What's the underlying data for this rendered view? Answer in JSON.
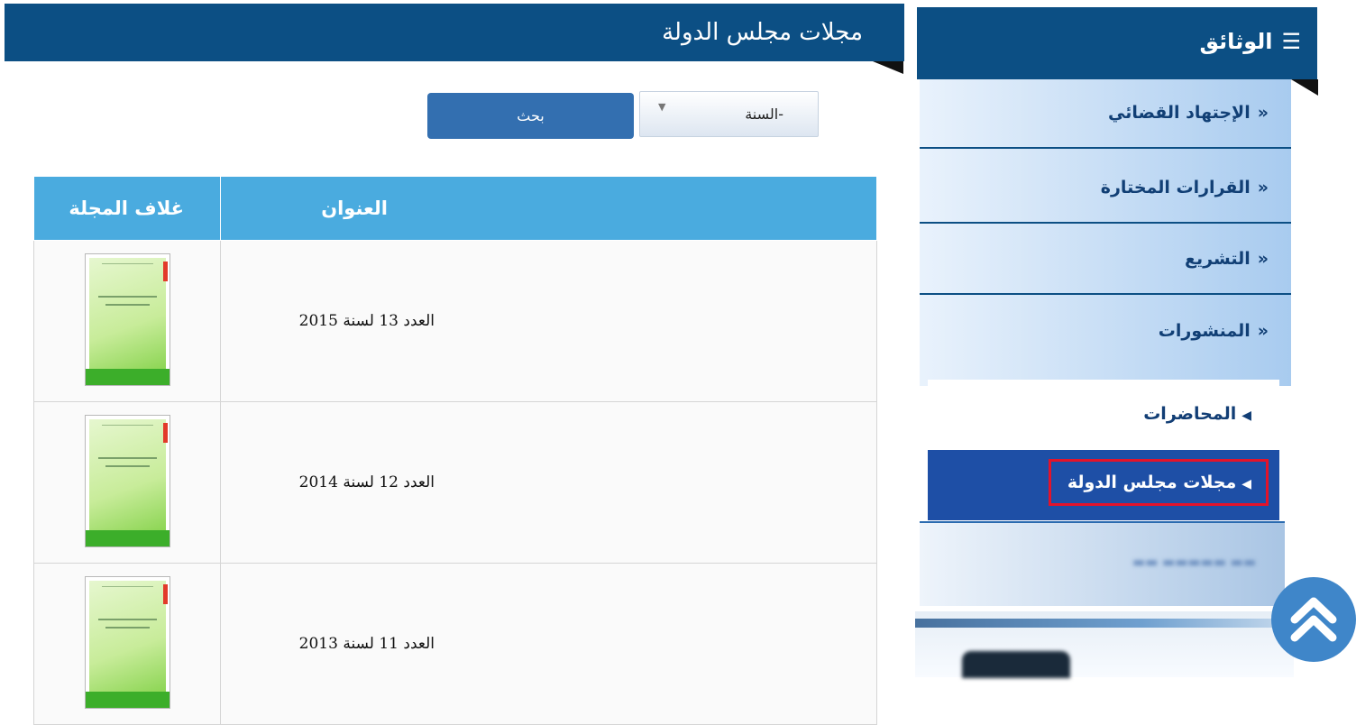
{
  "main_header": {
    "title": "مجلات مجلس الدولة"
  },
  "search": {
    "year_select_value": "-السنة",
    "search_button": "بحث"
  },
  "table": {
    "columns": {
      "title": "العنوان",
      "cover": "غلاف المجلة"
    },
    "rows": [
      {
        "title": "العدد 13 لسنة 2015"
      },
      {
        "title": "العدد 12 لسنة 2014"
      },
      {
        "title": "العدد 11 لسنة 2013"
      }
    ]
  },
  "sidebar": {
    "header": "الوثائق",
    "header_icon": "list-icon",
    "items": [
      {
        "label": "الإجتهاد القضائي"
      },
      {
        "label": "القرارات المختارة"
      },
      {
        "label": "التشريع"
      },
      {
        "label": "المنشورات"
      }
    ],
    "sub_items": [
      {
        "label": "المحاضرات",
        "active": false
      },
      {
        "label": "مجلات مجلس الدولة",
        "active": true
      }
    ]
  },
  "colors": {
    "header_bg": "#0c4f84",
    "table_header_bg": "#4aabdf",
    "search_button_bg": "#336fb0",
    "active_item_bg": "#1e4fa6",
    "highlight_border": "#e4132a"
  },
  "icons": {
    "scroll_top": "double-chevron-up-icon"
  }
}
